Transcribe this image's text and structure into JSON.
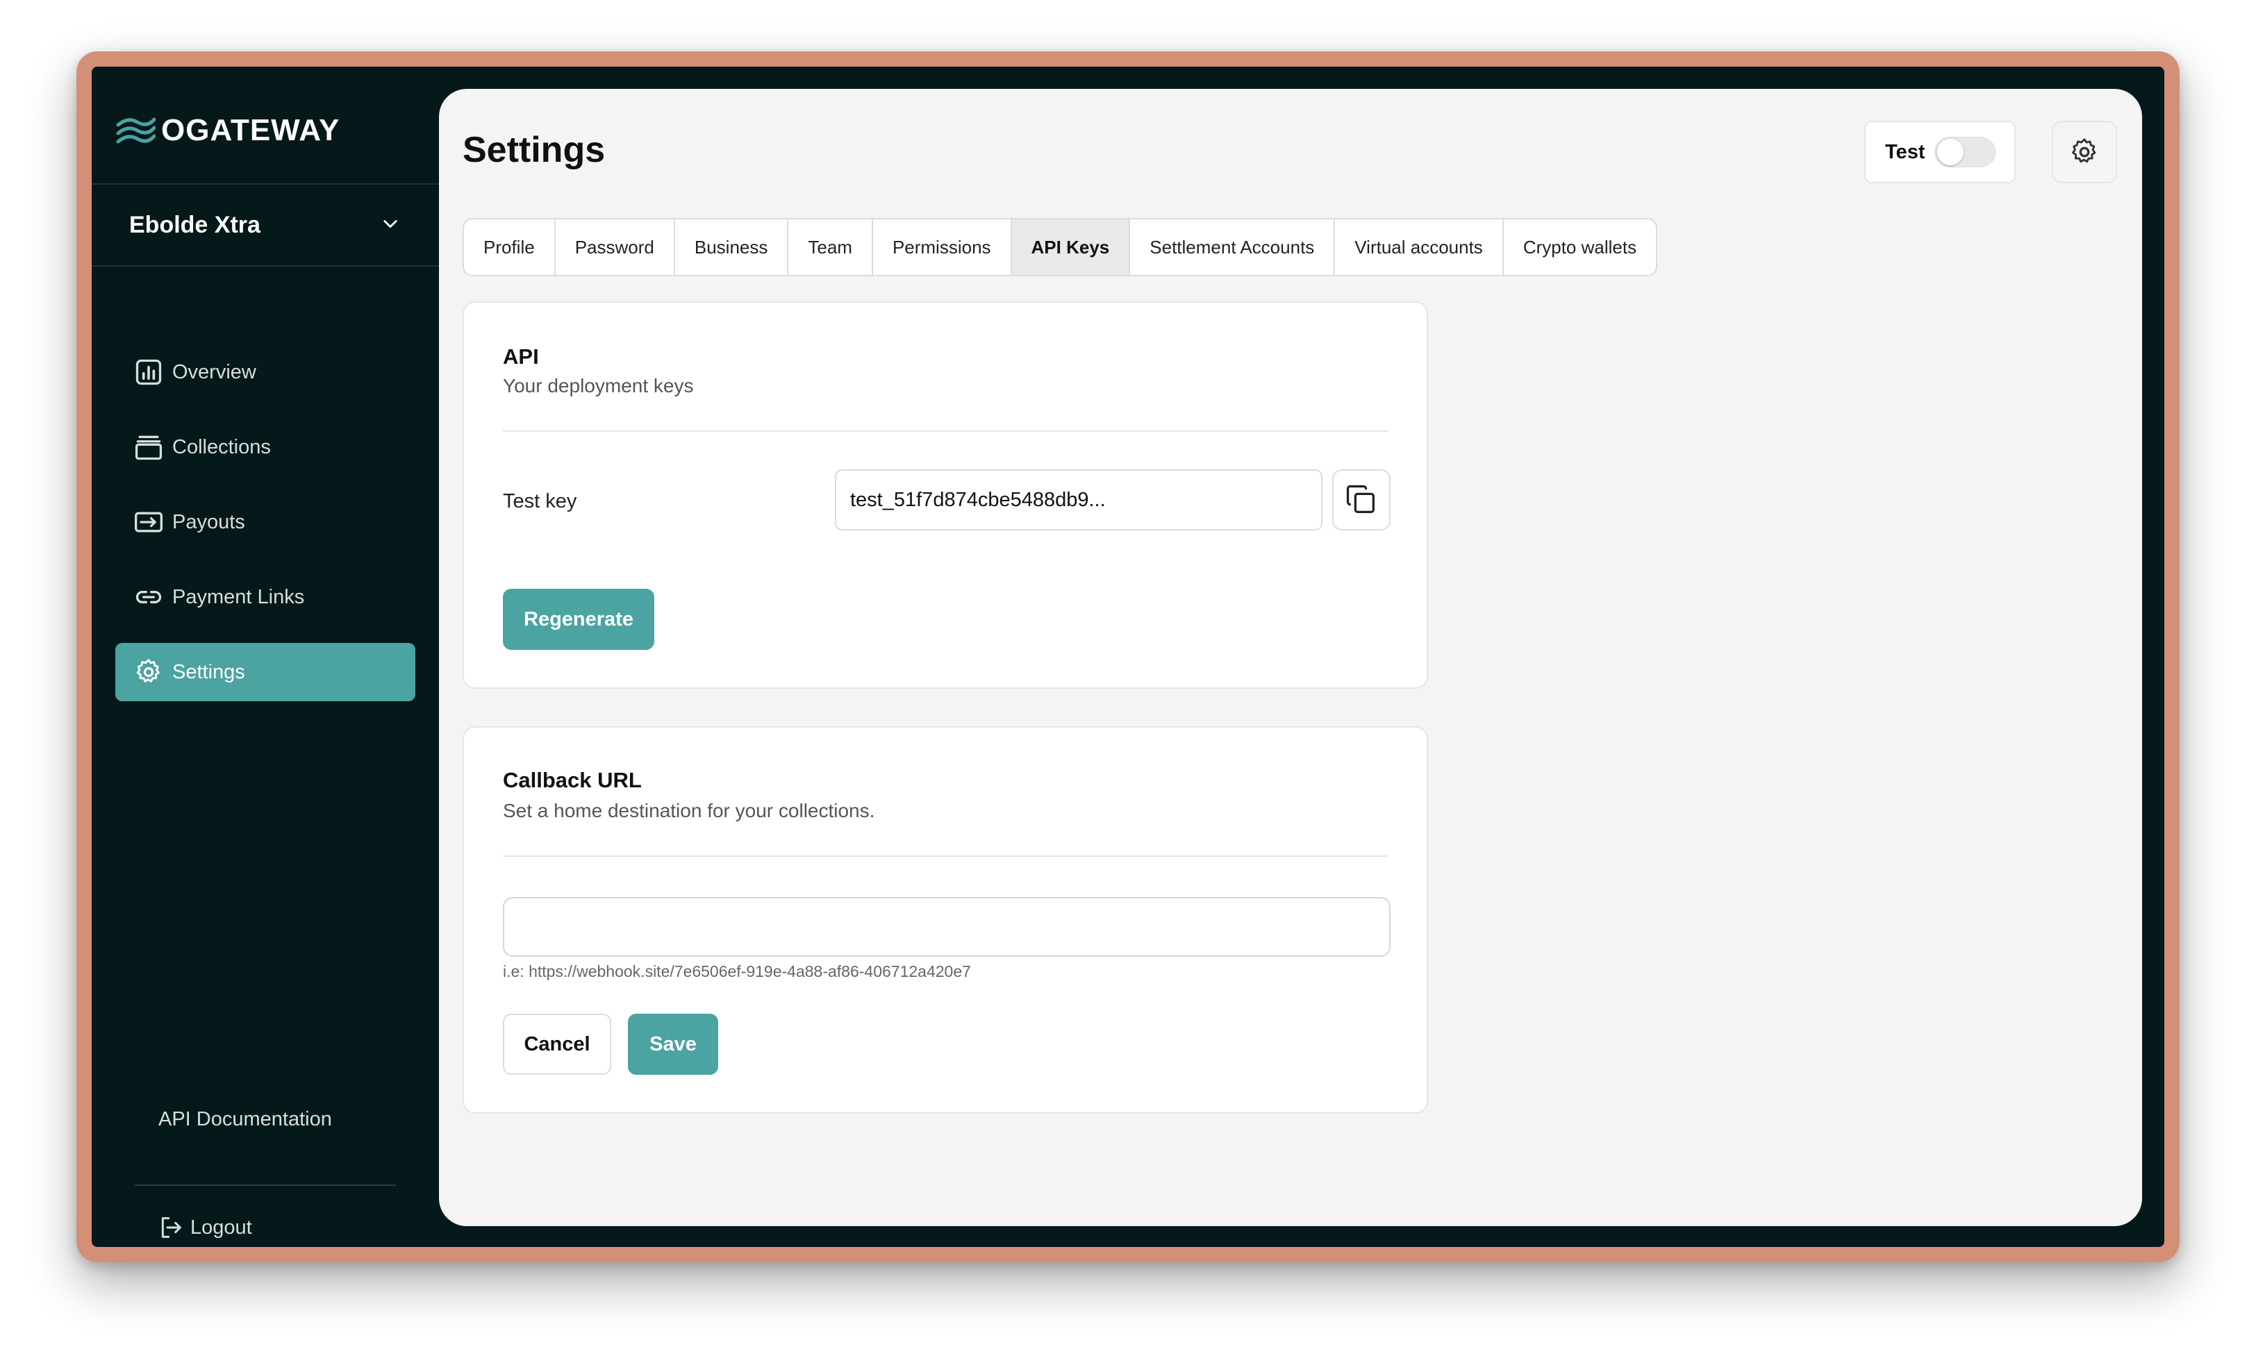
{
  "brand": {
    "name": "OGATEWAY",
    "accent": "#4ba3a2",
    "sidebar_bg": "#06191a"
  },
  "business": {
    "name": "Ebolde Xtra"
  },
  "nav": {
    "items": [
      {
        "label": "Overview",
        "icon": "bar-chart-icon"
      },
      {
        "label": "Collections",
        "icon": "collections-icon"
      },
      {
        "label": "Payouts",
        "icon": "payouts-icon"
      },
      {
        "label": "Payment Links",
        "icon": "link-icon"
      },
      {
        "label": "Settings",
        "icon": "gear-icon",
        "active": true
      }
    ],
    "api_docs": "API Documentation",
    "logout": "Logout"
  },
  "header": {
    "title": "Settings",
    "mode_label": "Test",
    "mode_enabled": false
  },
  "tabs": [
    {
      "label": "Profile"
    },
    {
      "label": "Password"
    },
    {
      "label": "Business"
    },
    {
      "label": "Team"
    },
    {
      "label": "Permissions"
    },
    {
      "label": "API Keys",
      "active": true
    },
    {
      "label": "Settlement Accounts"
    },
    {
      "label": "Virtual accounts"
    },
    {
      "label": "Crypto wallets"
    }
  ],
  "api_card": {
    "title": "API",
    "subtitle": "Your deployment keys",
    "key_label": "Test key",
    "key_value": "test_51f7d874cbe5488db9...",
    "regenerate": "Regenerate"
  },
  "callback_card": {
    "title": "Callback URL",
    "subtitle": "Set a home destination for your collections.",
    "input_value": "",
    "hint": "i.e: https://webhook.site/7e6506ef-919e-4a88-af86-406712a420e7",
    "cancel": "Cancel",
    "save": "Save"
  }
}
